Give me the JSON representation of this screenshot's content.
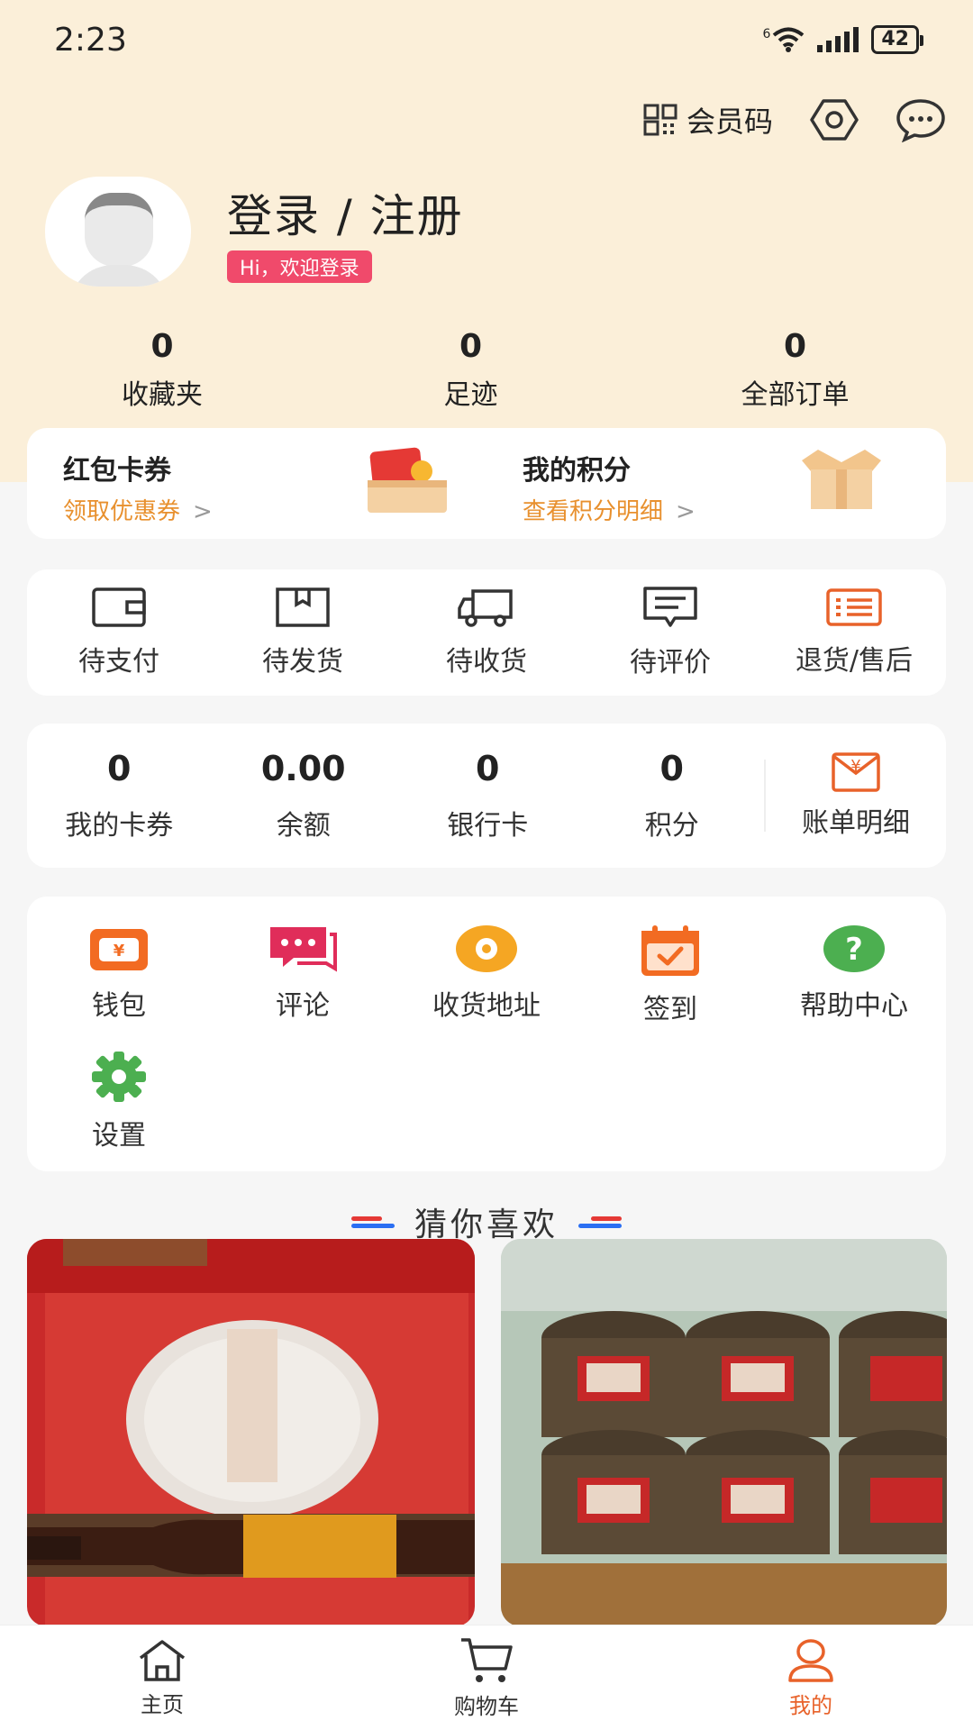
{
  "status_bar": {
    "time": "2:23",
    "network": "6",
    "battery": "42"
  },
  "header": {
    "member_code_label": "会员码"
  },
  "profile": {
    "login_title": "登录 / 注册",
    "welcome": "Hi，欢迎登录"
  },
  "stats": [
    {
      "value": "0",
      "label": "收藏夹"
    },
    {
      "value": "0",
      "label": "足迹"
    },
    {
      "value": "0",
      "label": "全部订单"
    }
  ],
  "coupons": {
    "left": {
      "title": "红包卡券",
      "subtitle": "领取优惠券"
    },
    "right": {
      "title": "我的积分",
      "subtitle": "查看积分明细"
    }
  },
  "orders": [
    {
      "label": "待支付",
      "icon": "wallet-icon"
    },
    {
      "label": "待发货",
      "icon": "box-icon"
    },
    {
      "label": "待收货",
      "icon": "truck-icon"
    },
    {
      "label": "待评价",
      "icon": "comment-icon"
    },
    {
      "label": "退货/售后",
      "icon": "list-icon"
    }
  ],
  "wallet": {
    "items": [
      {
        "value": "0",
        "label": "我的卡券"
      },
      {
        "value": "0.00",
        "label": "余额"
      },
      {
        "value": "0",
        "label": "银行卡"
      },
      {
        "value": "0",
        "label": "积分"
      }
    ],
    "bill": {
      "label": "账单明细",
      "icon_text": "¥"
    }
  },
  "tools": [
    {
      "label": "钱包",
      "icon": "wallet-tool-icon",
      "icon_text": "¥"
    },
    {
      "label": "评论",
      "icon": "chat-icon"
    },
    {
      "label": "收货地址",
      "icon": "location-icon"
    },
    {
      "label": "签到",
      "icon": "calendar-check-icon"
    },
    {
      "label": "帮助中心",
      "icon": "help-icon",
      "icon_text": "?"
    },
    {
      "label": "设置",
      "icon": "gear-icon"
    }
  ],
  "recommend": {
    "title": "猜你喜欢"
  },
  "tabbar": [
    {
      "label": "主页",
      "icon": "home-icon",
      "active": false
    },
    {
      "label": "购物车",
      "icon": "cart-icon",
      "active": false
    },
    {
      "label": "我的",
      "icon": "user-icon",
      "active": true
    }
  ],
  "colors": {
    "accent": "#e8622a",
    "header_bg": "#fbefd9",
    "badge": "#f04a6b",
    "help_green": "#4caf50",
    "location_yellow": "#f5a623"
  }
}
